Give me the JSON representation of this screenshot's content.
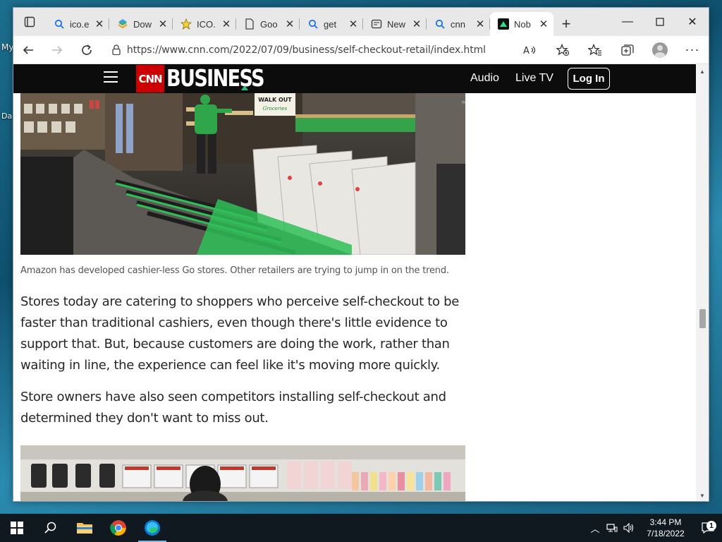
{
  "desktop": {
    "fragments": [
      "My",
      "Da"
    ]
  },
  "browser": {
    "tabs": [
      {
        "label": "ico.e",
        "icon": "search-icon"
      },
      {
        "label": "Dow",
        "icon": "download-icon"
      },
      {
        "label": "ICO.",
        "icon": "star-icon"
      },
      {
        "label": "Goo",
        "icon": "document-icon"
      },
      {
        "label": "get",
        "icon": "search-icon"
      },
      {
        "label": "New",
        "icon": "newspaper-icon"
      },
      {
        "label": "cnn",
        "icon": "search-icon"
      },
      {
        "label": "Nob",
        "icon": "nobl-icon",
        "active": true
      }
    ],
    "url": "https://www.cnn.com/2022/07/09/business/self-checkout-retail/index.html"
  },
  "site": {
    "logo": "CNN",
    "section": "BUSINESS",
    "nav": {
      "audio": "Audio",
      "live_tv": "Live TV",
      "login": "Log In"
    }
  },
  "article": {
    "caption": "Amazon has developed cashier-less Go stores. Other retailers are trying to jump in on the trend.",
    "paragraphs": [
      "Stores today are catering to shoppers who perceive self-checkout to be faster than traditional cashiers, even though there's little evidence to support that. But, because customers are doing the work, rather than waiting in line, the experience can feel like it's moving more quickly.",
      "Store owners have also seen competitors installing self-checkout and determined they don't want to miss out."
    ],
    "photo1_sign": "WALK OUT",
    "photo1_sign_sub": "Groceries"
  },
  "taskbar": {
    "time": "3:44 PM",
    "date": "7/18/2022",
    "notifications": "1"
  },
  "colors": {
    "cnn_red": "#cc0000",
    "edge_blue": "#0a7cd8",
    "accent_green": "#29c07e"
  }
}
